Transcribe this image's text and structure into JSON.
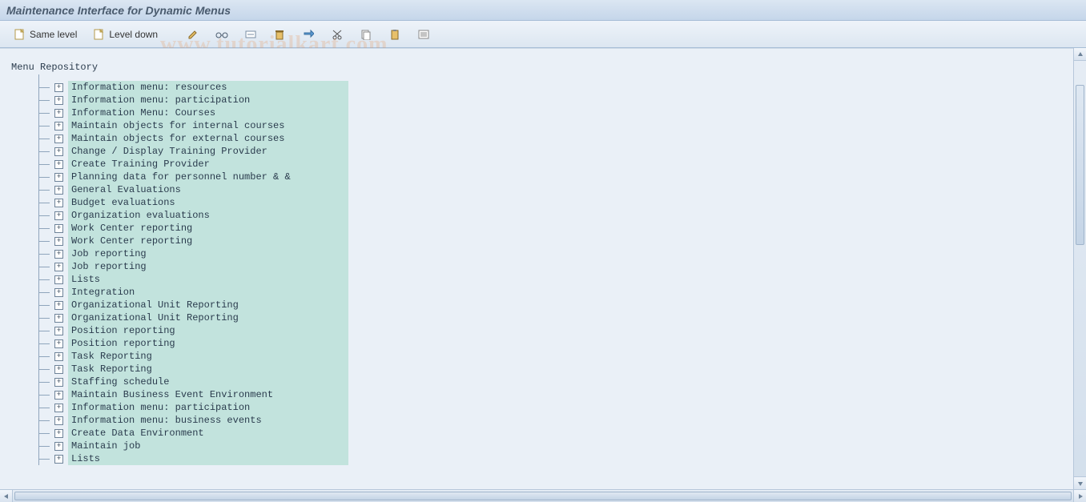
{
  "title": "Maintenance Interface for Dynamic Menus",
  "watermark": "www.tutorialkart.com",
  "toolbar": {
    "same_level": "Same level",
    "level_down": "Level down"
  },
  "root_label": "Menu Repository",
  "items": [
    {
      "label": "Information menu: resources"
    },
    {
      "label": "Information menu: participation"
    },
    {
      "label": "Information Menu: Courses"
    },
    {
      "label": "Maintain objects for internal courses"
    },
    {
      "label": "Maintain objects for external courses"
    },
    {
      "label": "Change / Display Training Provider"
    },
    {
      "label": "Create Training Provider"
    },
    {
      "label": "Planning data for personnel number & &"
    },
    {
      "label": "General Evaluations"
    },
    {
      "label": "Budget evaluations"
    },
    {
      "label": "Organization evaluations"
    },
    {
      "label": "Work Center reporting"
    },
    {
      "label": "Work Center reporting"
    },
    {
      "label": "Job reporting"
    },
    {
      "label": "Job reporting"
    },
    {
      "label": "Lists"
    },
    {
      "label": "Integration"
    },
    {
      "label": "Organizational Unit Reporting"
    },
    {
      "label": "Organizational Unit Reporting"
    },
    {
      "label": "Position reporting"
    },
    {
      "label": "Position reporting"
    },
    {
      "label": "Task Reporting"
    },
    {
      "label": "Task Reporting"
    },
    {
      "label": "Staffing schedule"
    },
    {
      "label": "Maintain Business Event Environment"
    },
    {
      "label": "Information menu: participation"
    },
    {
      "label": "Information menu: business events"
    },
    {
      "label": "Create Data Environment"
    },
    {
      "label": "Maintain job"
    },
    {
      "label": "Lists"
    }
  ]
}
